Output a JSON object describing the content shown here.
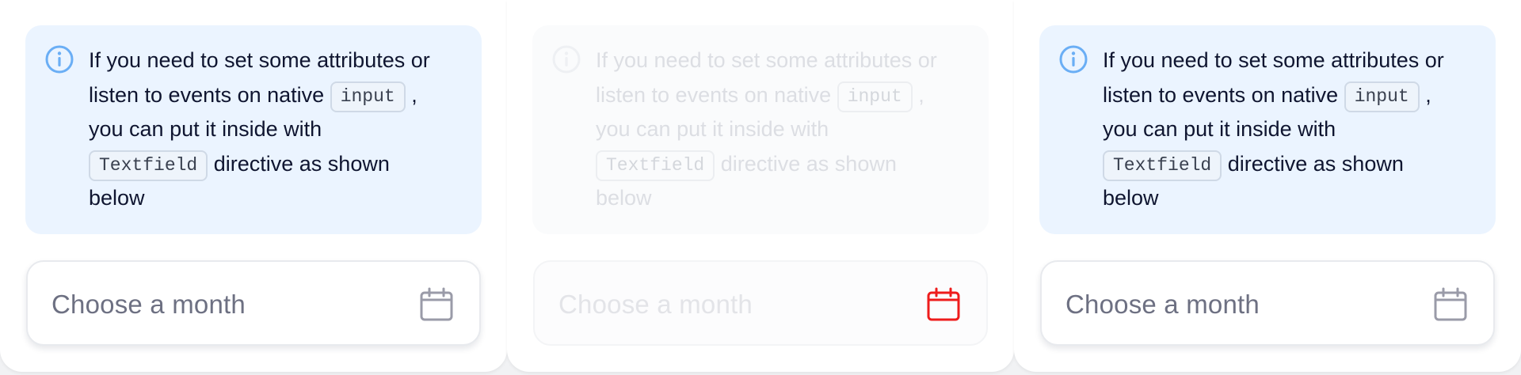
{
  "alert": {
    "line1": "If you need to set some attributes or",
    "line2a": "listen to events on native",
    "code1": "input",
    "line2b": ",",
    "line3": "you can put it inside with",
    "code2": "Textfield",
    "line4b": "directive as shown",
    "line5": "below",
    "icon": "info-icon"
  },
  "field": {
    "placeholder": "Choose a month",
    "icon": "calendar-icon"
  },
  "colors": {
    "alert_bg": "#ebf4ff",
    "info_icon": "#6aaef5",
    "calendar_icon": "#9a9ba8",
    "calendar_icon_focused": "#ee1c1c",
    "disabled_text": "#dcdee3"
  },
  "states": [
    "default",
    "disabled",
    "default"
  ]
}
